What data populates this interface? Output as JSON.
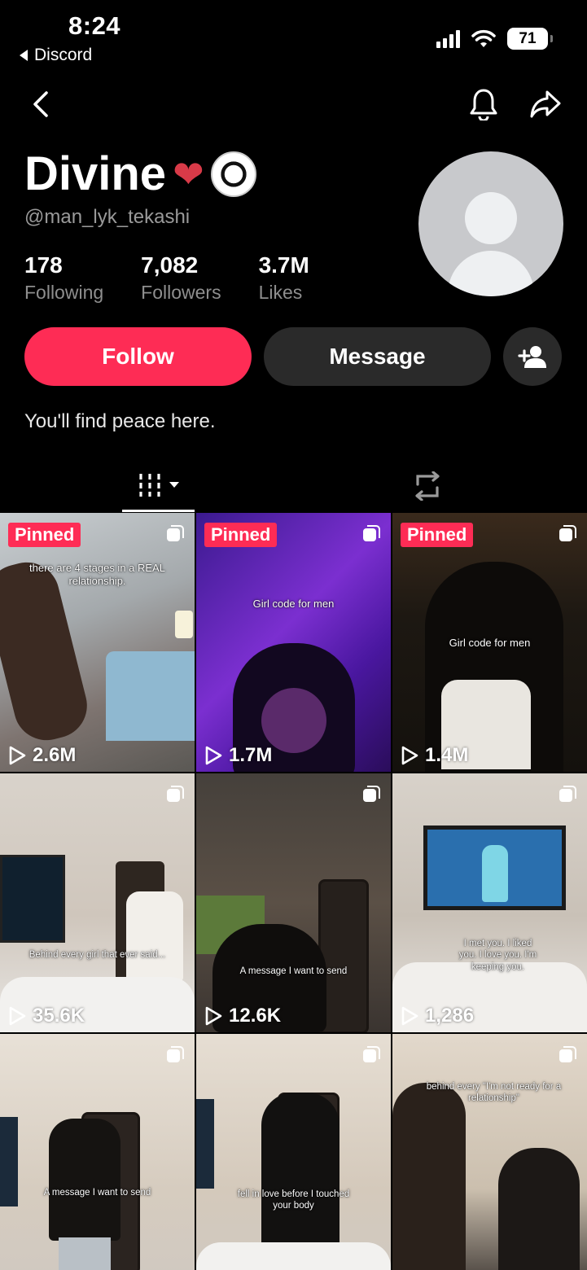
{
  "status_bar": {
    "time": "8:24",
    "back_app": "Discord",
    "battery": "71"
  },
  "nav": {
    "back_icon": "chevron-left-icon",
    "bell_icon": "bell-icon",
    "share_icon": "share-arrow-icon"
  },
  "profile": {
    "display_name": "Divine",
    "name_emojis": [
      "anatomical-heart-emoji",
      "soccer-ball-emoji"
    ],
    "username": "@man_lyk_tekashi",
    "stats": [
      {
        "value": "178",
        "label": "Following"
      },
      {
        "value": "7,082",
        "label": "Followers"
      },
      {
        "value": "3.7M",
        "label": "Likes"
      }
    ],
    "follow_label": "Follow",
    "message_label": "Message",
    "bio": "You'll find peace here."
  },
  "colors": {
    "accent": "#fe2c55",
    "secondary_button": "#2a2a2a",
    "muted_text": "#8e8e8e"
  },
  "tabs": [
    {
      "icon": "videos-grid-icon",
      "active": true
    },
    {
      "icon": "repost-icon",
      "active": false
    }
  ],
  "videos": [
    {
      "pinned_label": "Pinned",
      "caption": "there are 4 stages in a REAL relationship.",
      "plays": "2.6M"
    },
    {
      "pinned_label": "Pinned",
      "caption": "Girl code for men",
      "plays": "1.7M"
    },
    {
      "pinned_label": "Pinned",
      "caption": "Girl code for men",
      "plays": "1.4M"
    },
    {
      "pinned_label": "",
      "caption": "Behind every girl that ever said...",
      "plays": "35.6K"
    },
    {
      "pinned_label": "",
      "caption": "A message I want to send",
      "plays": "12.6K"
    },
    {
      "pinned_label": "",
      "caption": "I met you. I liked you. I love you. I'm keeping you.",
      "plays": "1,286"
    },
    {
      "pinned_label": "",
      "caption": "A message I want to send",
      "plays": ""
    },
    {
      "pinned_label": "",
      "caption": "fell in love before I touched your body",
      "plays": ""
    },
    {
      "pinned_label": "",
      "caption": "behind every \"I'm not ready for a relationship\"",
      "plays": ""
    }
  ]
}
